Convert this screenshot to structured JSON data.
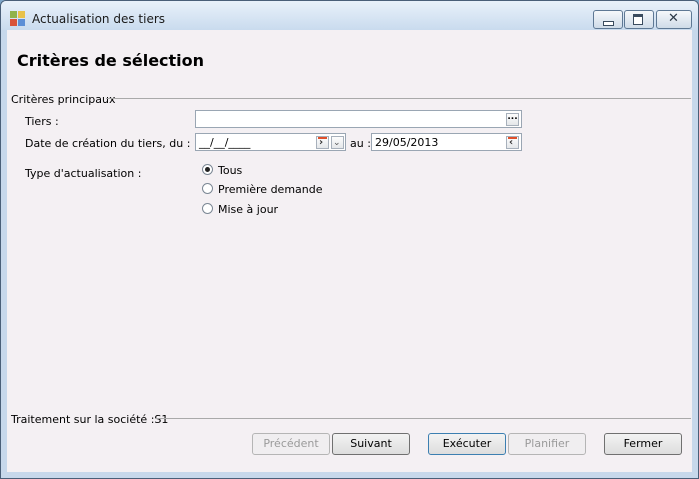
{
  "window": {
    "title": "Actualisation des tiers"
  },
  "page": {
    "heading": "Critères de sélection"
  },
  "criteria": {
    "group_label": "Critères principaux",
    "tiers_label": "Tiers :",
    "tiers_value": "",
    "tiers_button": "...",
    "date_label": "Date de création du tiers, du :",
    "date_from_value": "__/__/____",
    "date_to_label": "au :",
    "date_to_value": "29/05/2013",
    "type_label": "Type d'actualisation :",
    "options": [
      {
        "label": "Tous",
        "selected": true
      },
      {
        "label": "Première demande",
        "selected": false
      },
      {
        "label": "Mise à jour",
        "selected": false
      }
    ]
  },
  "footer": {
    "company_label": "Traitement sur la société :S1"
  },
  "buttons": {
    "previous": "Précédent",
    "next": "Suivant",
    "execute": "Exécuter",
    "schedule": "Planifier",
    "close": "Fermer"
  },
  "colors": {
    "accent_red": "#e0502c",
    "title_bar": "#c9dbee",
    "client_bg": "#f4f0f3"
  }
}
